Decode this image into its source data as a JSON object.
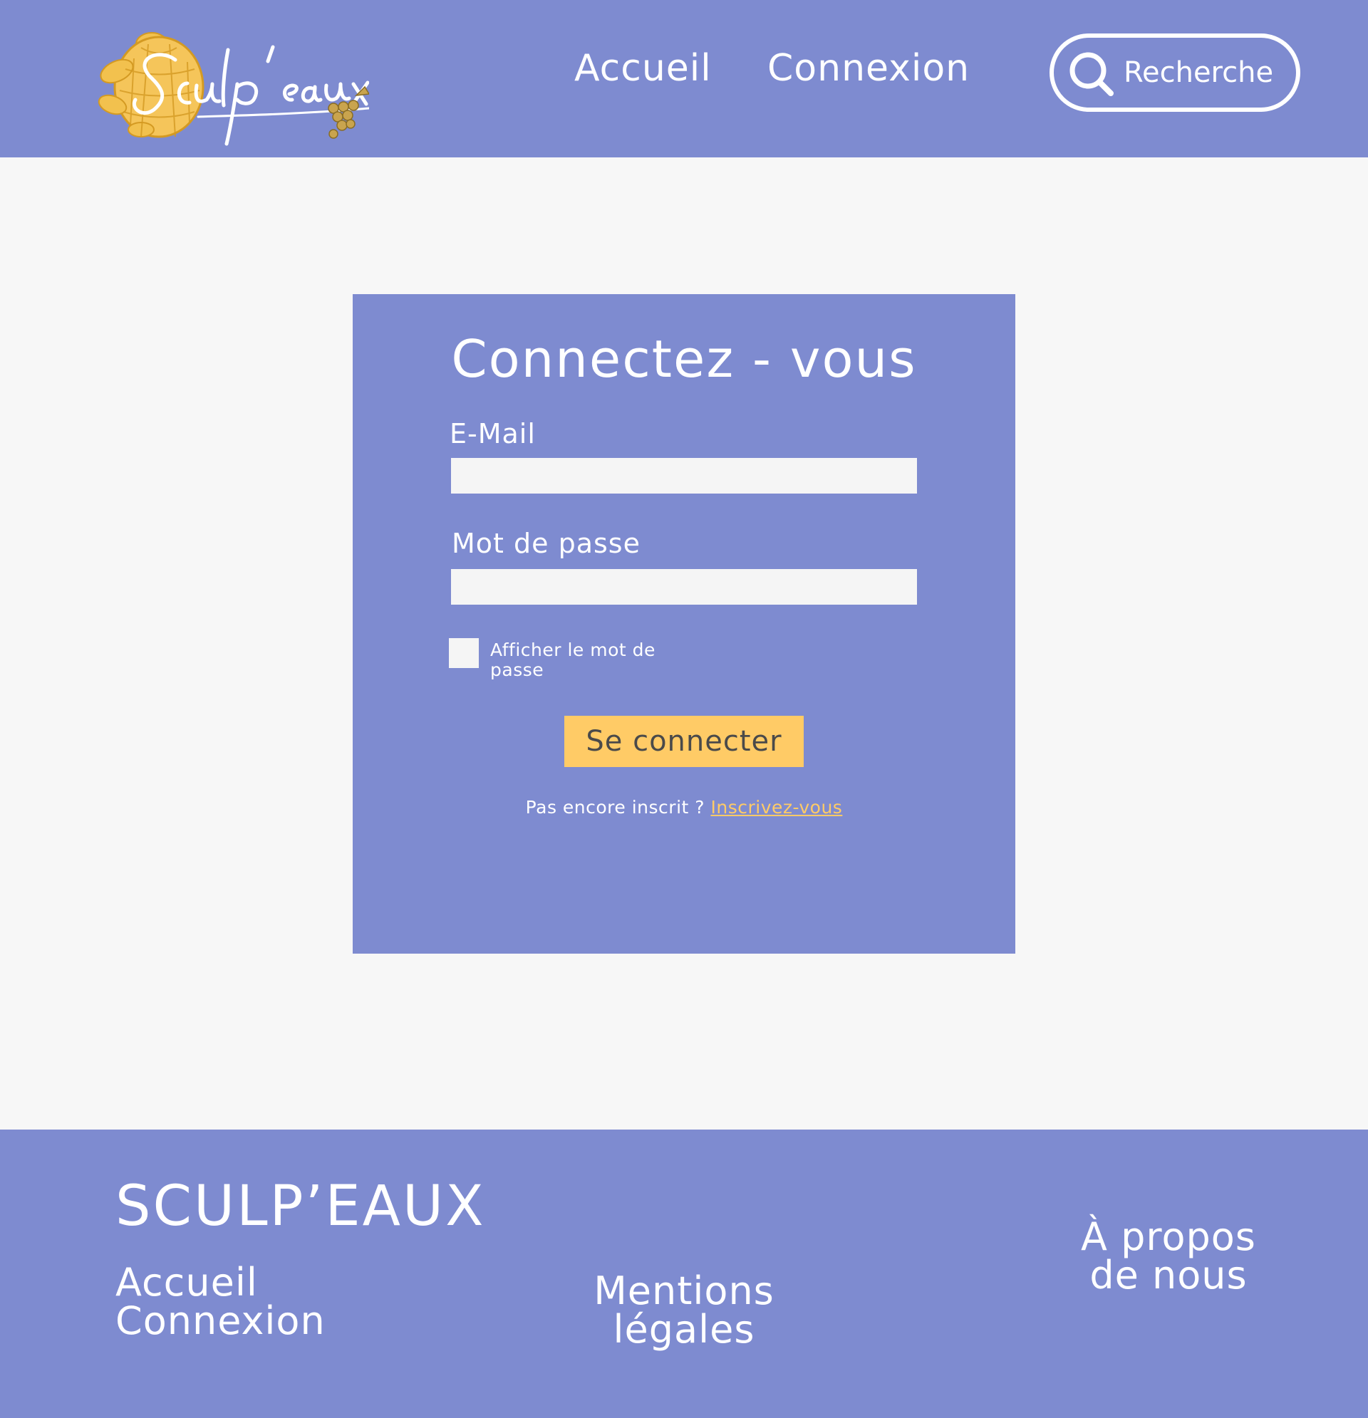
{
  "header": {
    "logo_text": "Sculp'eaux",
    "nav": {
      "home": "Accueil",
      "login": "Connexion"
    },
    "search": {
      "placeholder": "Recherche"
    }
  },
  "login_form": {
    "title": "Connectez - vous",
    "email_label": "E-Mail",
    "email_value": "",
    "password_label": "Mot de passe",
    "password_value": "",
    "show_password_label": "Afficher le mot de passe",
    "show_password_checked": false,
    "submit_label": "Se connecter",
    "signup_prompt": "Pas encore inscrit ?",
    "signup_link": "Inscrivez-vous"
  },
  "footer": {
    "brand": "SCULP’EAUX",
    "home": "Accueil",
    "login": "Connexion",
    "legal": "Mentions légales",
    "about": "À propos de nous"
  },
  "colors": {
    "primary": "#7e8bd0",
    "background": "#f7f7f7",
    "accent": "#ffcb66",
    "text_light": "#ffffff",
    "button_text": "#4a4a4a"
  }
}
